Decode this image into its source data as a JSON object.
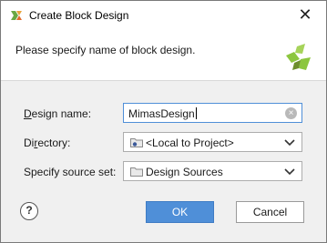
{
  "window": {
    "title": "Create Block Design",
    "close_glyph": "✕"
  },
  "header": {
    "prompt": "Please specify name of block design."
  },
  "form": {
    "design_name": {
      "label_hotkey": "D",
      "label_rest": "esign name:",
      "value": "MimasDesign"
    },
    "directory": {
      "label_pre": "Di",
      "label_hotkey": "r",
      "label_rest": "ectory:",
      "value": "<Local to Project>",
      "icon": "folder-local-icon"
    },
    "source_set": {
      "label": "Specify source set:",
      "value": "Design Sources",
      "icon": "folder-icon"
    }
  },
  "buttons": {
    "help": "?",
    "ok": "OK",
    "cancel": "Cancel"
  },
  "colors": {
    "accent": "#4f8fd8",
    "logo_green": "#8cc63f",
    "logo_dark": "#6d8e2c"
  }
}
